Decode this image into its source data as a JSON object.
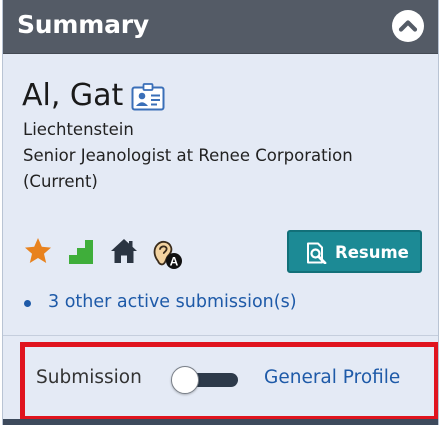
{
  "header": {
    "title": "Summary",
    "collapse_icon": "chevron-up-icon"
  },
  "candidate": {
    "name": "Al, Gat",
    "contact_icon": "contact-card-icon",
    "location": "Liechtenstein",
    "position": "Senior Jeanologist at Renee Corporation",
    "status": "(Current)"
  },
  "indicators": [
    {
      "icon": "star-icon",
      "color": "#e8821e"
    },
    {
      "icon": "steps-icon",
      "color": "#3fae3a"
    },
    {
      "icon": "home-icon",
      "color": "#2b3542"
    },
    {
      "icon": "ear-icon",
      "badge": "A"
    }
  ],
  "resume_button": {
    "label": "Resume",
    "icon": "document-search-icon",
    "color": "#1c8a95"
  },
  "other_submissions": {
    "label": "3 other active submission(s)"
  },
  "view_toggle": {
    "left_label": "Submission",
    "right_label": "General Profile",
    "state": "Submission"
  },
  "colors": {
    "header_bg": "#545b66",
    "card_bg": "#e4eaf5",
    "link": "#1e5aa8",
    "highlight": "#e0141e"
  }
}
